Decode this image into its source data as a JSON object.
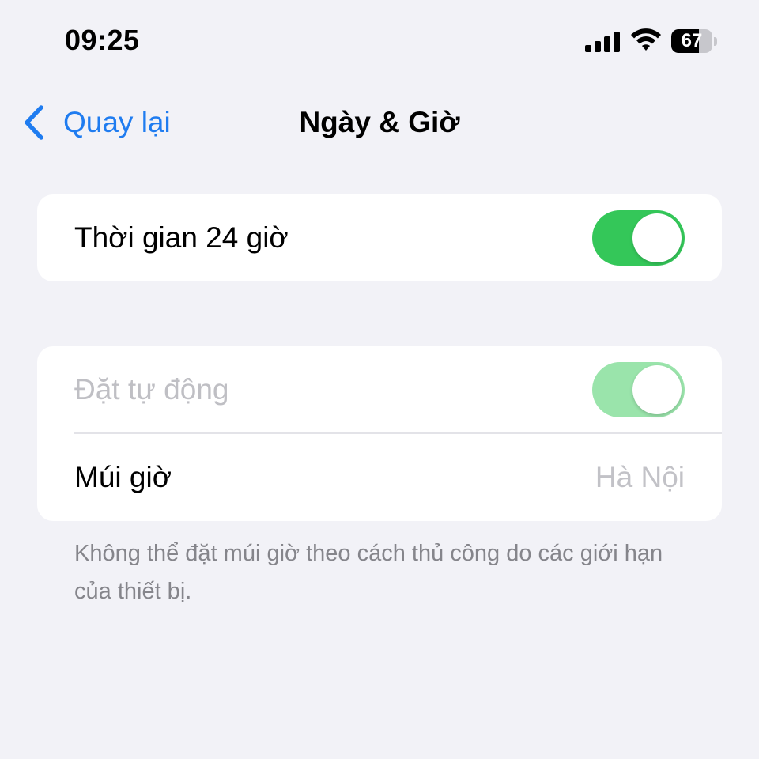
{
  "status_bar": {
    "time": "09:25",
    "battery_level": "67",
    "battery_fraction": 0.67,
    "icons": [
      "signal-icon",
      "wifi-icon",
      "battery-icon"
    ]
  },
  "nav": {
    "back_label": "Quay lại",
    "title": "Ngày & Giờ",
    "back_icon": "chevron-left-icon",
    "accent_color": "#1f7cf0"
  },
  "settings": {
    "time_24h": {
      "label": "Thời gian 24 giờ",
      "enabled": true
    },
    "auto_set": {
      "label": "Đặt tự động",
      "enabled": true,
      "disabled": true
    },
    "time_zone": {
      "label": "Múi giờ",
      "value": "Hà Nội"
    }
  },
  "footnote": "Không thể đặt múi giờ theo cách thủ công do các giới hạn của thiết bị.",
  "colors": {
    "background": "#f2f2f7",
    "toggle_on": "#34c759",
    "toggle_on_disabled": "#9ae4ab"
  }
}
